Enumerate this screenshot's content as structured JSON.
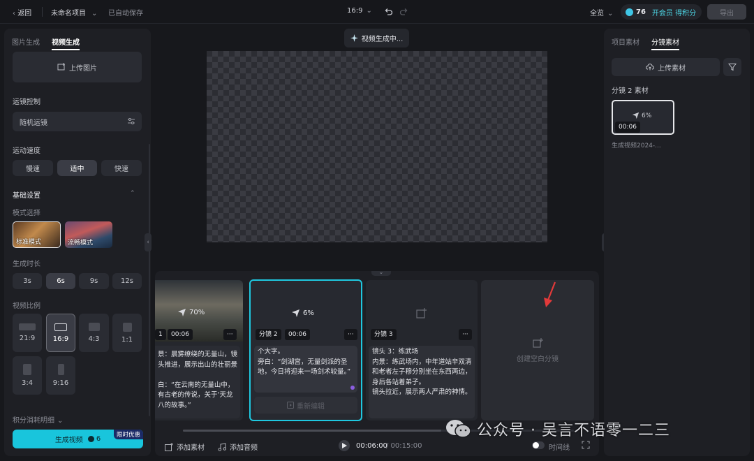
{
  "topbar": {
    "back": "返回",
    "project_name": "未命名项目",
    "saved": "已自动保存",
    "ratio": "16:9",
    "overview": "全览",
    "credits": "76",
    "vip": "开会员 得积分",
    "export": "导出"
  },
  "left": {
    "tabs": [
      "图片生成",
      "视频生成"
    ],
    "upload_image": "上传图片",
    "camera_control_label": "运镜控制",
    "camera_control_value": "随机运镜",
    "motion_speed_label": "运动速度",
    "speeds": [
      "慢速",
      "适中",
      "快速"
    ],
    "basic_settings": "基础设置",
    "mode_label": "模式选择",
    "modes": [
      "标准模式",
      "流畅模式"
    ],
    "duration_label": "生成时长",
    "durations": [
      "3s",
      "6s",
      "9s",
      "12s"
    ],
    "ratio_label": "视频比例",
    "ratios": [
      "21:9",
      "16:9",
      "4:3",
      "1:1",
      "3:4",
      "9:16"
    ],
    "credit_detail": "积分消耗明细",
    "generate": "生成视频",
    "generate_cost": "6",
    "promo": "限时优惠"
  },
  "center": {
    "status": "视频生成中..."
  },
  "timeline": {
    "cards": [
      {
        "label": "1",
        "time": "00:06",
        "progress": "70%",
        "text": "景：晨雾缭绕的无量山，镜头推进，展示出山的壮丽景\n\n白：“在云南的无量山中，有古老的传说，关于‘天龙八的故事。”"
      },
      {
        "label": "分镜 2",
        "time": "00:06",
        "progress": "6%",
        "text": "个大字。\n旁白：“剑湖宫，无量剑派的圣地，今日将迎来一场剑术较量。”",
        "regen": "重新编辑"
      },
      {
        "label": "分镜 3",
        "text": "镜头 3：练武场\n内景：练武场内，中年道姑辛双清和老者左子穆分别坐在东西两边，身后各站着弟子。\n镜头拉近，展示两人严肃的神情。"
      }
    ],
    "create_blank": "创建空白分镜",
    "add_material": "添加素材",
    "add_audio": "添加音频",
    "time_current": "00:06:00",
    "time_total": "/ 00:15:00",
    "timeline_toggle": "时间线"
  },
  "right": {
    "tabs": [
      "项目素材",
      "分镜素材"
    ],
    "upload": "上传素材",
    "section": "分镜 2 素材",
    "thumb_progress": "6%",
    "thumb_time": "00:06",
    "thumb_name": "生成视频2024-..."
  },
  "watermark": {
    "text": "公众号 · 吴言不语零一二三"
  },
  "colors": {
    "accent": "#1fc8e0",
    "generate_button": "#19c5dc",
    "promo": "#1b2a66",
    "marker": "#e23a3a"
  }
}
